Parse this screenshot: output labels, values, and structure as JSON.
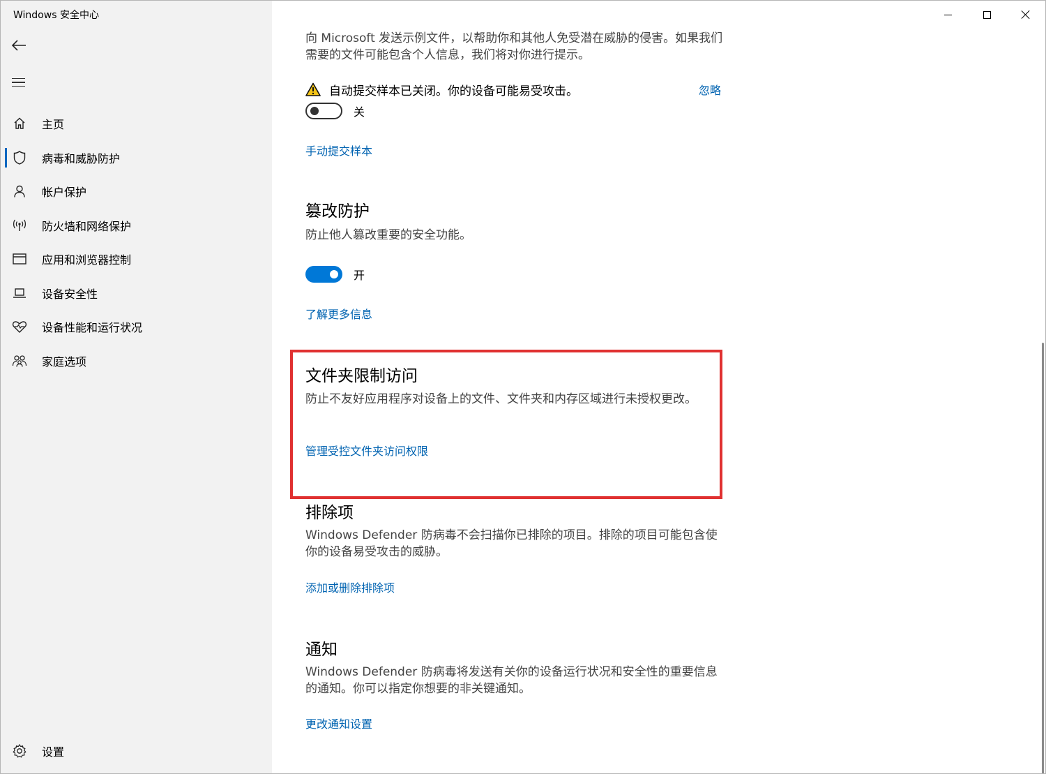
{
  "window": {
    "title": "Windows 安全中心"
  },
  "sidebar": {
    "items": [
      {
        "label": "主页",
        "icon": "home-icon"
      },
      {
        "label": "病毒和威胁防护",
        "icon": "shield-icon",
        "selected": true
      },
      {
        "label": "帐户保护",
        "icon": "person-icon"
      },
      {
        "label": "防火墙和网络保护",
        "icon": "antenna-icon"
      },
      {
        "label": "应用和浏览器控制",
        "icon": "browser-window-icon"
      },
      {
        "label": "设备安全性",
        "icon": "laptop-icon"
      },
      {
        "label": "设备性能和运行状况",
        "icon": "heart-pulse-icon"
      },
      {
        "label": "家庭选项",
        "icon": "family-icon"
      }
    ],
    "settings_label": "设置"
  },
  "main": {
    "sample_desc": "向 Microsoft 发送示例文件，以帮助你和其他人免受潜在威胁的侵害。如果我们需要的文件可能包含个人信息，我们将对你进行提示。",
    "warning_text": "自动提交样本已关闭。你的设备可能易受攻击。",
    "dismiss_label": "忽略",
    "sample_toggle_label": "关",
    "manual_submit_link": "手动提交样本",
    "tamper": {
      "title": "篡改防护",
      "desc": "防止他人篡改重要的安全功能。",
      "toggle_label": "开",
      "link": "了解更多信息"
    },
    "folder_access": {
      "title": "文件夹限制访问",
      "desc": "防止不友好应用程序对设备上的文件、文件夹和内存区域进行未授权更改。",
      "link": "管理受控文件夹访问权限"
    },
    "exclusions": {
      "title": "排除项",
      "desc": "Windows Defender 防病毒不会扫描你已排除的项目。排除的项目可能包含使你的设备易受攻击的威胁。",
      "link": "添加或删除排除项"
    },
    "notifications": {
      "title": "通知",
      "desc": "Windows Defender 防病毒将发送有关你的设备运行状况和安全性的重要信息的通知。你可以指定你想要的非关键通知。",
      "link": "更改通知设置"
    }
  },
  "colors": {
    "accent": "#0078d7",
    "link": "#0063b1",
    "highlight": "#e03131",
    "warning": "#f5c518"
  }
}
